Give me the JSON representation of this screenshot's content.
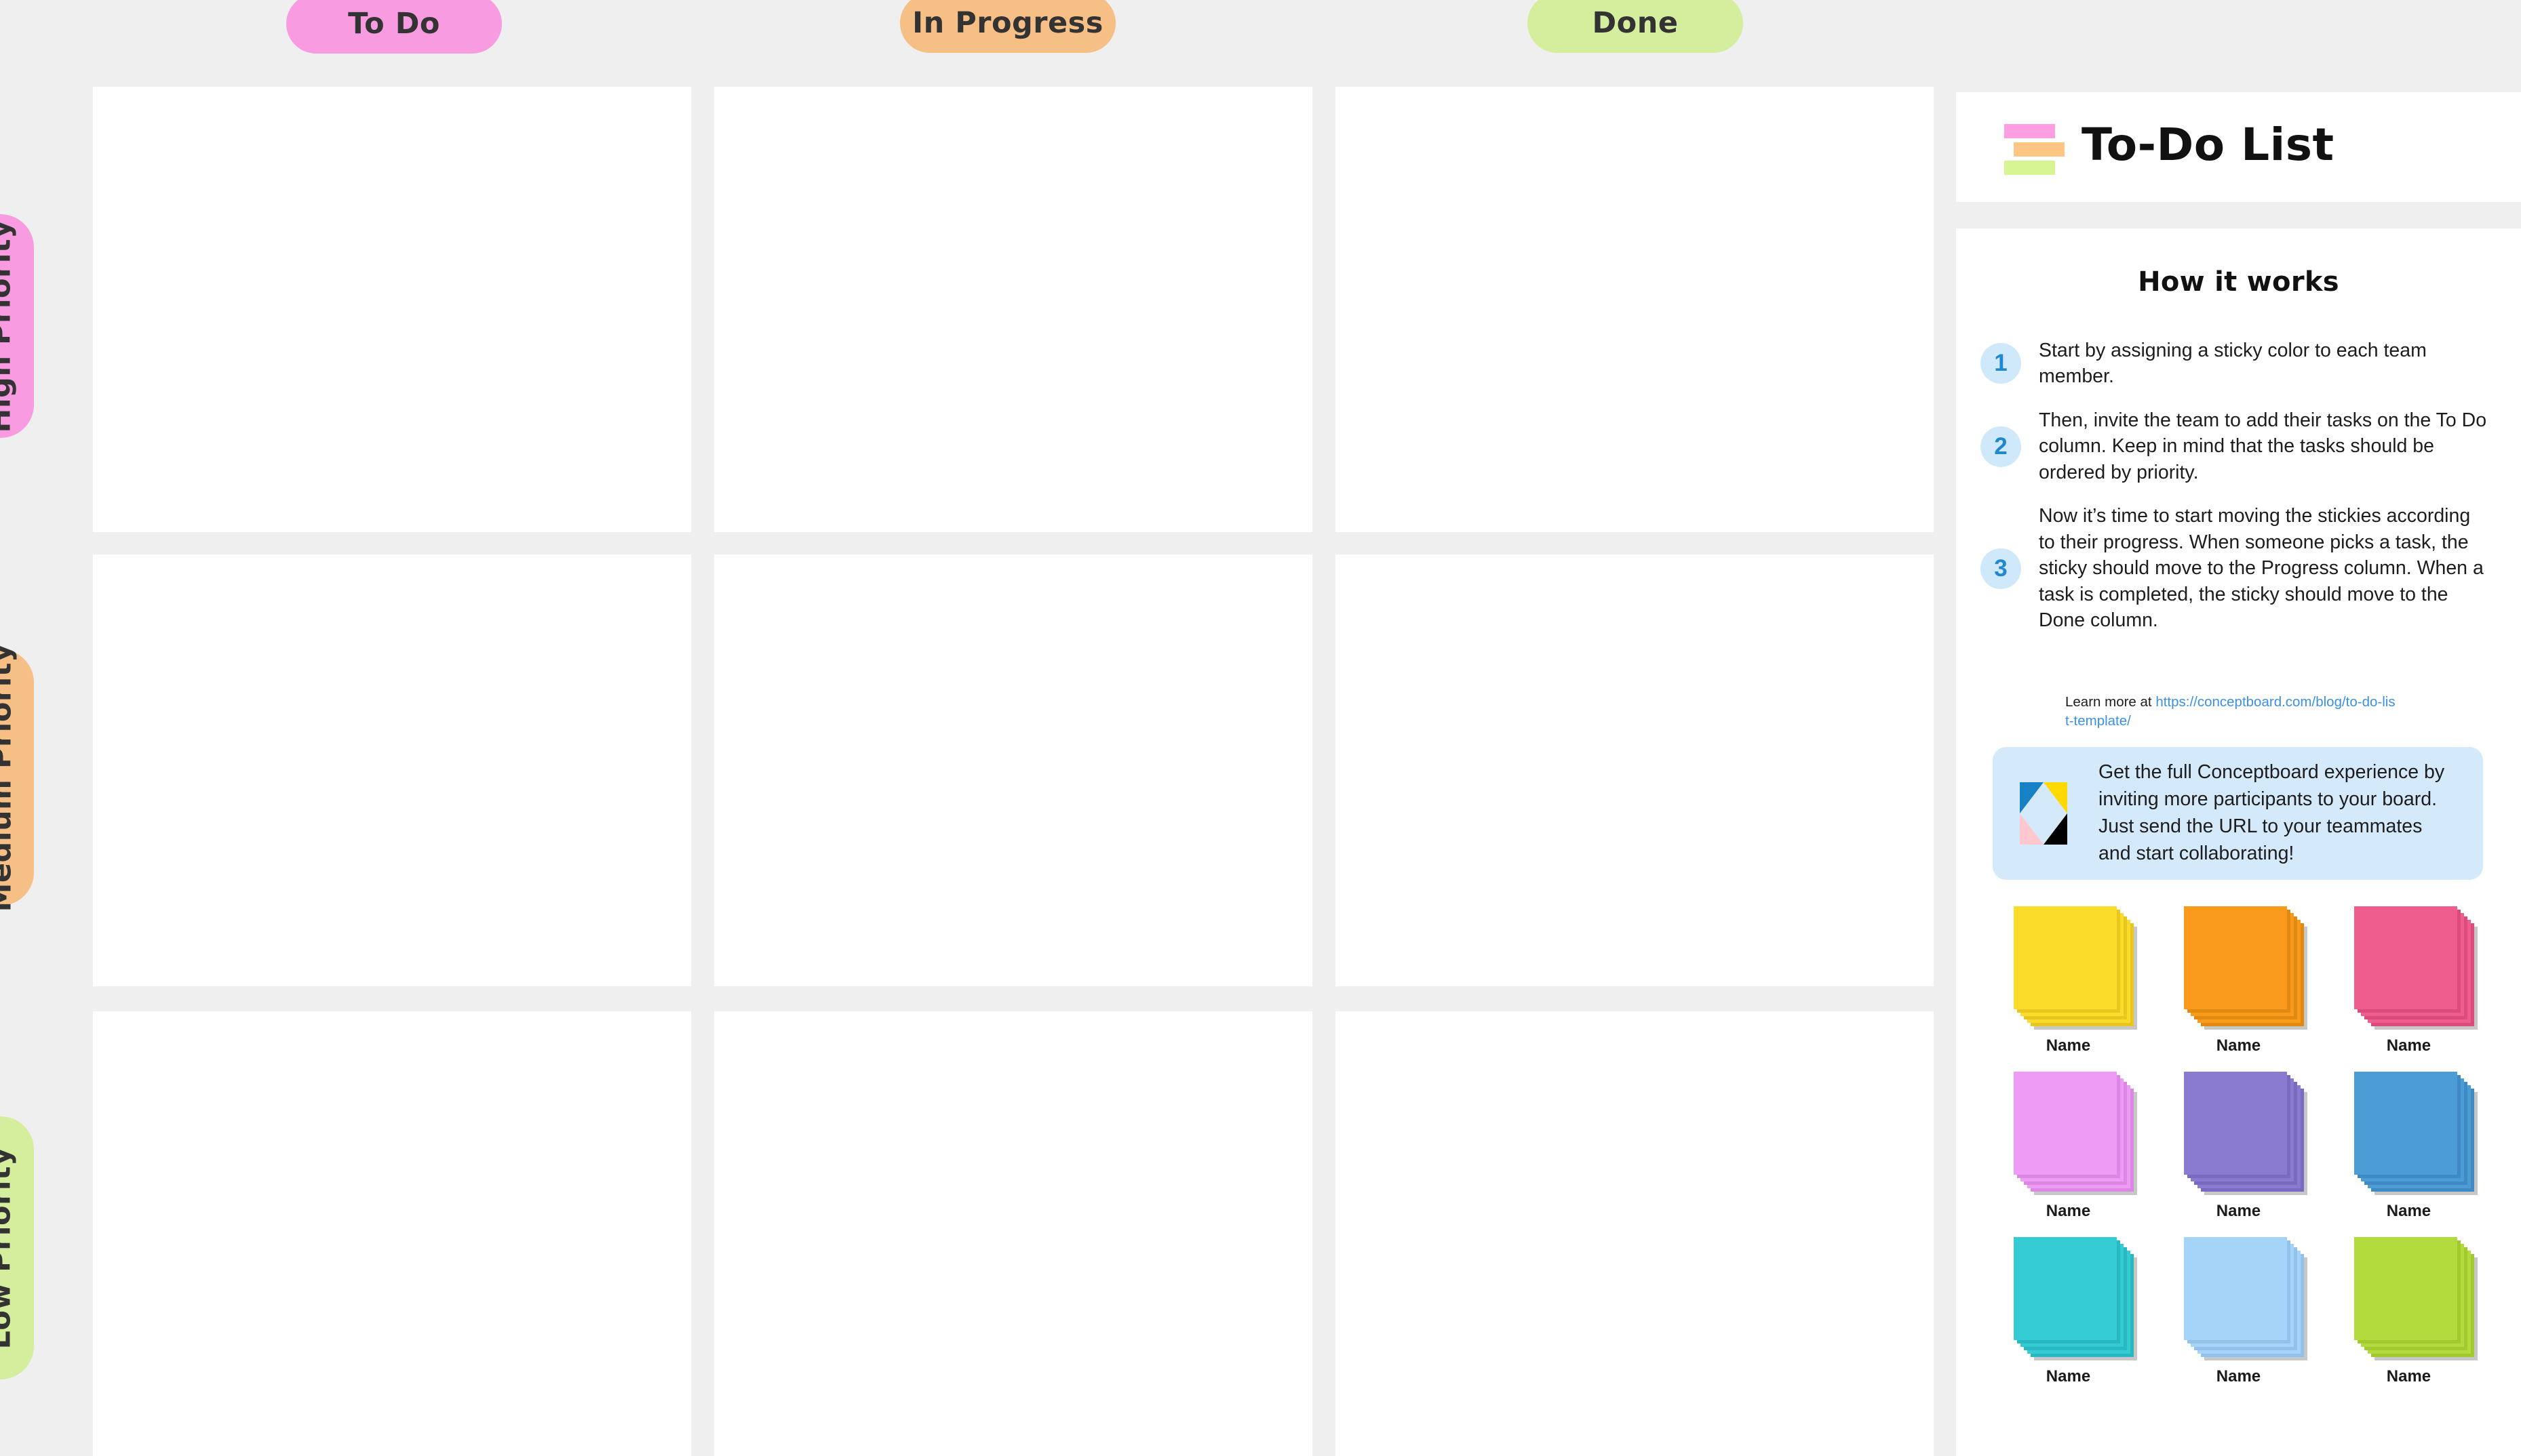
{
  "board": {
    "background_color": "#efefef",
    "columns": [
      {
        "label": "To Do",
        "color": "#F89BE0"
      },
      {
        "label": "In Progress",
        "color": "#F6BF85"
      },
      {
        "label": "Done",
        "color": "#D4EE9D"
      }
    ],
    "rows": [
      {
        "label": "High Priority",
        "color": "#F89BE0"
      },
      {
        "label": "Medium Priority",
        "color": "#F6BF85"
      },
      {
        "label": "Low Priority",
        "color": "#D4EE9D"
      }
    ],
    "cells": [
      {
        "column": "To Do",
        "row": "High Priority",
        "content": ""
      },
      {
        "column": "In Progress",
        "row": "High Priority",
        "content": ""
      },
      {
        "column": "Done",
        "row": "High Priority",
        "content": ""
      },
      {
        "column": "To Do",
        "row": "Medium Priority",
        "content": ""
      },
      {
        "column": "In Progress",
        "row": "Medium Priority",
        "content": ""
      },
      {
        "column": "Done",
        "row": "Medium Priority",
        "content": ""
      },
      {
        "column": "To Do",
        "row": "Low Priority",
        "content": ""
      },
      {
        "column": "In Progress",
        "row": "Low Priority",
        "content": ""
      },
      {
        "column": "Done",
        "row": "Low Priority",
        "content": ""
      }
    ]
  },
  "sidebar": {
    "header": {
      "title": "To-Do List",
      "logo_colors": [
        "#FD9DE2",
        "#FDC684",
        "#D7F592"
      ]
    },
    "how_it_works": {
      "heading": "How it works",
      "highlight_color": "#FBE98C",
      "steps": [
        {
          "number": "1",
          "text": "Start by assigning a sticky color to each team member."
        },
        {
          "number": "2",
          "text": "Then, invite the team to add their tasks on the To Do column. Keep in mind that the tasks should be ordered by priority."
        },
        {
          "number": "3",
          "text": "Now it’s time to start moving the stickies according to their progress. When someone picks a task, the sticky should move to the Progress column. When a task is completed, the sticky should move to the Done column."
        }
      ],
      "step_badge_bg": "#CFE8FA",
      "step_badge_fg": "#2188D0"
    },
    "learn_more": {
      "prefix": "Learn more at ",
      "link_text": "https://conceptboard.com/blog/to-do-list-template/",
      "link_color": "#3C90DF"
    },
    "promo": {
      "text": "Get the full Conceptboard experience by inviting more participants to your board. Just send the URL to your teammates and start collaborating!",
      "background": "#D4E9FA",
      "logo_colors": {
        "top_left": "#1682C5",
        "top_right": "#FFD900",
        "bottom_left": "#FFC8CE",
        "bottom_right": "#000000"
      }
    },
    "palette": {
      "label": "Name",
      "swatches": [
        {
          "name": "Name",
          "color": "#FCDC2A",
          "shade": "#E8C81F"
        },
        {
          "name": "Name",
          "color": "#F99A1C",
          "shade": "#E08A12"
        },
        {
          "name": "Name",
          "color": "#EF5C8E",
          "shade": "#DB4C7D"
        },
        {
          "name": "Name",
          "color": "#EE9BF5",
          "shade": "#DC87E4"
        },
        {
          "name": "Name",
          "color": "#8B7BD0",
          "shade": "#7B6BC0"
        },
        {
          "name": "Name",
          "color": "#4C9CD6",
          "shade": "#3F8AC3"
        },
        {
          "name": "Name",
          "color": "#34CBD4",
          "shade": "#27B8C1"
        },
        {
          "name": "Name",
          "color": "#A5D4F8",
          "shade": "#92C2E9"
        },
        {
          "name": "Name",
          "color": "#B2DC3D",
          "shade": "#A0CA2E"
        }
      ]
    }
  }
}
